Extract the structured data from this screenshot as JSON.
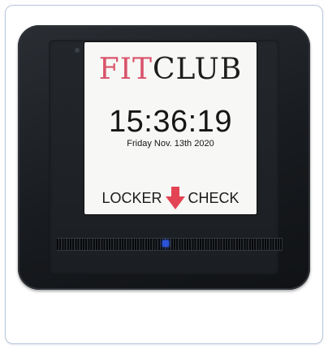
{
  "screen": {
    "logo_fit": "FIT",
    "logo_club": "CLUB",
    "time": "15:36:19",
    "date": "Friday Nov. 13th 2020",
    "locker_label": "LOCKER",
    "check_label": "CHECK",
    "arrow_icon": "down-arrow-icon"
  },
  "colors": {
    "brand_fit": "#d9536b",
    "arrow": "#e34453",
    "led": "#2c53d6"
  }
}
